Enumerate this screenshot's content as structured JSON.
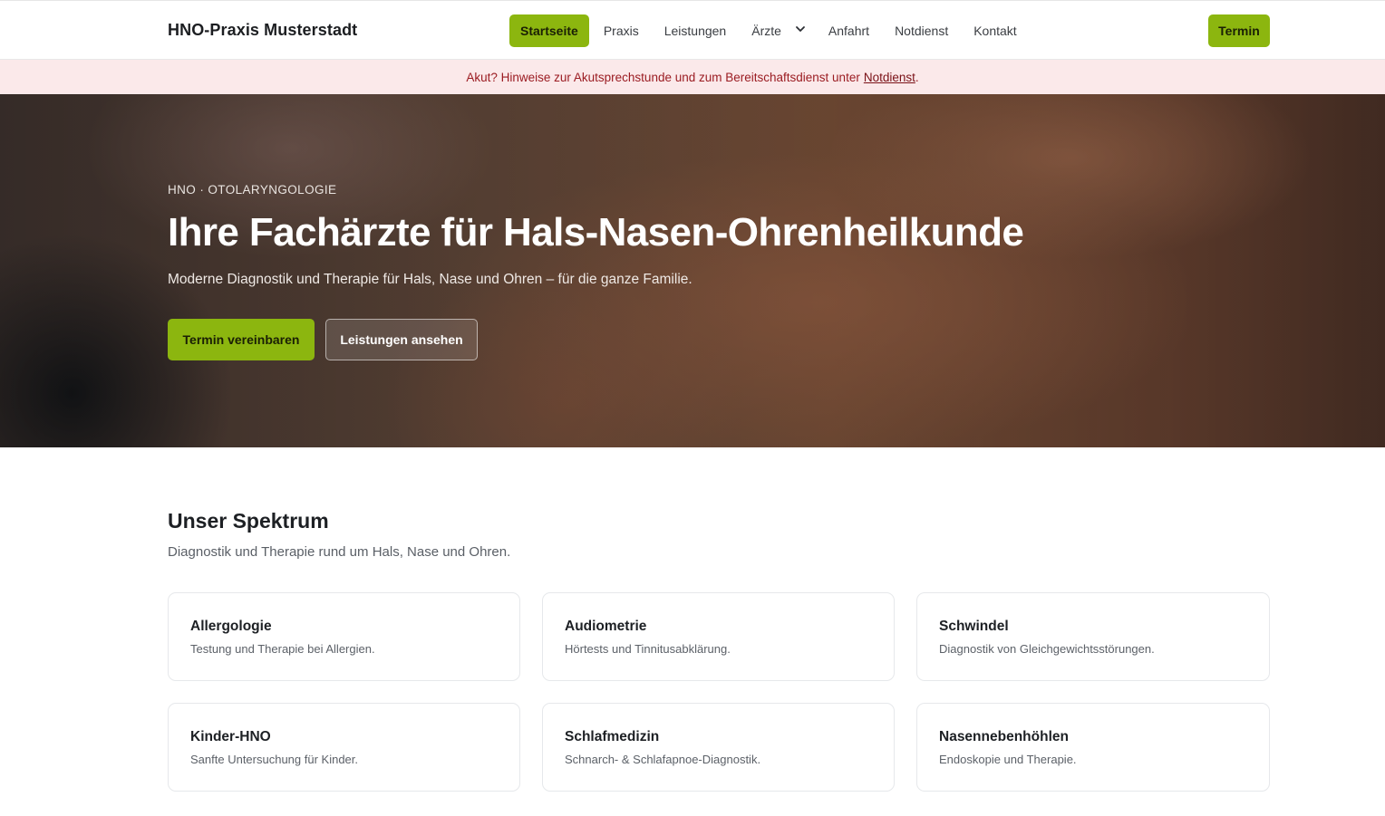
{
  "header": {
    "brand": "HNO-Praxis Musterstadt",
    "nav": [
      {
        "label": "Startseite",
        "active": true
      },
      {
        "label": "Praxis"
      },
      {
        "label": "Leistungen"
      },
      {
        "label": "Ärzte",
        "has_dropdown": true
      },
      {
        "label": "Anfahrt"
      },
      {
        "label": "Notdienst"
      },
      {
        "label": "Kontakt"
      }
    ],
    "cta_label": "Termin",
    "chevron_icon": "chevron-down-icon"
  },
  "alert": {
    "text": "Akut? Hinweise zur Akutsprechstunde und zum Bereitschaftsdienst unter",
    "link_label": "Notdienst",
    "suffix": "."
  },
  "hero": {
    "kicker": "HNO · OTOLARYNGOLOGIE",
    "title": "Ihre Fachärzte für Hals-Nasen-Ohrenheilkunde",
    "subtitle": "Moderne Diagnostik und Therapie für Hals, Nase und Ohren – für die ganze Familie.",
    "primary_button": "Termin vereinbaren",
    "secondary_button": "Leistungen ansehen"
  },
  "spectrum": {
    "title": "Unser Spektrum",
    "subtitle": "Diagnostik und Therapie rund um Hals, Nase und Ohren.",
    "cards": [
      {
        "title": "Allergologie",
        "desc": "Testung und Therapie bei Allergien."
      },
      {
        "title": "Audiometrie",
        "desc": "Hörtests und Tinnitusabklärung."
      },
      {
        "title": "Schwindel",
        "desc": "Diagnostik von Gleichgewichtsstörungen."
      },
      {
        "title": "Kinder-HNO",
        "desc": "Sanfte Untersuchung für Kinder."
      },
      {
        "title": "Schlafmedizin",
        "desc": "Schnarch- & Schlafapnoe-Diagnostik."
      },
      {
        "title": "Nasennebenhöhlen",
        "desc": "Endoskopie und Therapie."
      }
    ]
  },
  "colors": {
    "accent": "#8cb60f",
    "alert_bg": "#fbe9ea",
    "alert_text": "#9b1c22"
  }
}
